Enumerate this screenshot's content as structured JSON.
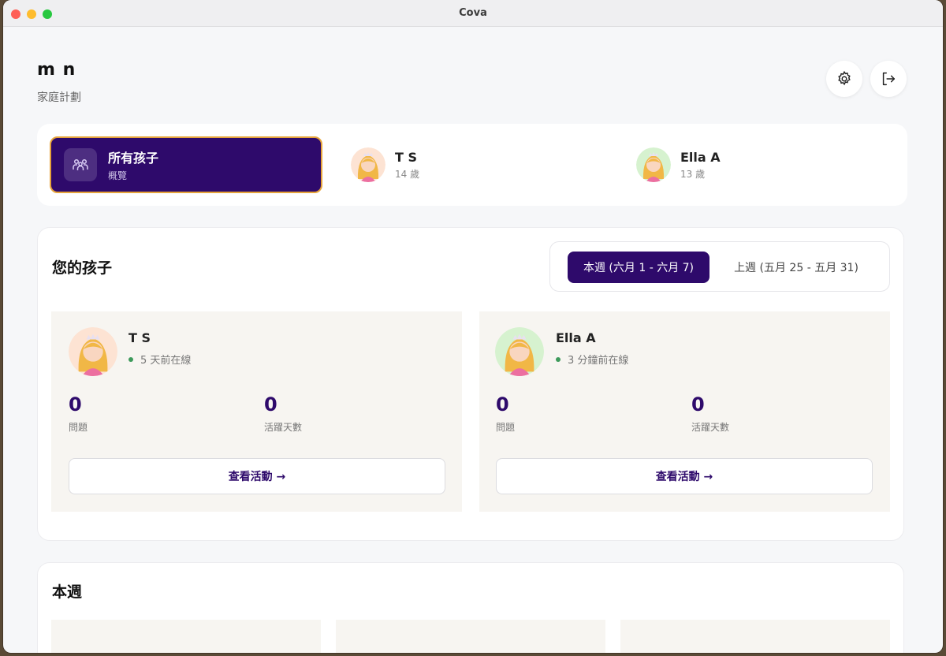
{
  "window": {
    "title": "Cova"
  },
  "header": {
    "user_name": "m n",
    "plan": "家庭計劃"
  },
  "kid_tabs": [
    {
      "title": "所有孩子",
      "subtitle": "概覽"
    },
    {
      "name": "T S",
      "age": "14 歲"
    },
    {
      "name": "Ella A",
      "age": "13 歲"
    }
  ],
  "your_kids": {
    "title": "您的孩子",
    "week_toggle": {
      "current": "本週 (六月 1 - 六月 7)",
      "previous": "上週 (五月 25 - 五月 31)"
    },
    "children": [
      {
        "name": "T S",
        "status": "5 天前在線",
        "questions_value": "0",
        "questions_label": "問題",
        "active_days_value": "0",
        "active_days_label": "活躍天數",
        "view_label": "查看活動 →"
      },
      {
        "name": "Ella A",
        "status": "3 分鐘前在線",
        "questions_value": "0",
        "questions_label": "問題",
        "active_days_value": "0",
        "active_days_label": "活躍天數",
        "view_label": "查看活動 →"
      }
    ]
  },
  "this_week": {
    "title": "本週"
  },
  "colors": {
    "accent": "#2e0a6b",
    "active_border": "#e6a33a",
    "online": "#3d9a5b"
  },
  "icons": [
    "settings-icon",
    "logout-icon",
    "family-icon"
  ]
}
